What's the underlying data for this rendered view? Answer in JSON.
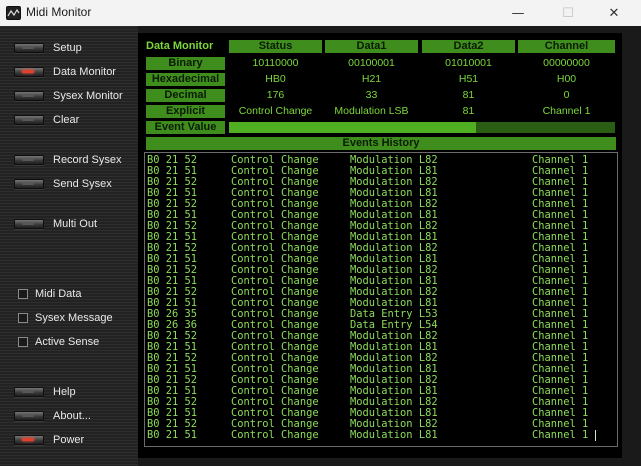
{
  "window": {
    "title": "Midi Monitor",
    "minimize_glyph": "—",
    "maximize_glyph": "☐",
    "close_glyph": "✕"
  },
  "sidebar": {
    "buttons": [
      {
        "label": "Setup",
        "led_on": false
      },
      {
        "label": "Data Monitor",
        "led_on": true
      },
      {
        "label": "Sysex Monitor",
        "led_on": false
      },
      {
        "label": "Clear",
        "led_on": false
      },
      {
        "label": "Record Sysex",
        "led_on": false
      },
      {
        "label": "Send Sysex",
        "led_on": false
      },
      {
        "label": "Multi Out",
        "led_on": false
      }
    ],
    "checkboxes": [
      {
        "label": "Midi Data",
        "checked": false
      },
      {
        "label": "Sysex Message",
        "checked": false
      },
      {
        "label": "Active Sense",
        "checked": false
      }
    ],
    "bottom_buttons": [
      {
        "label": "Help",
        "led_on": false
      },
      {
        "label": "About...",
        "led_on": false
      },
      {
        "label": "Power",
        "led_on": true
      }
    ]
  },
  "monitor": {
    "title": "Data Monitor",
    "columns": [
      "Status",
      "Data1",
      "Data2",
      "Channel"
    ],
    "rows": [
      {
        "label": "Binary",
        "values": [
          "10110000",
          "00100001",
          "01010001",
          "00000000"
        ]
      },
      {
        "label": "Hexadecimal",
        "values": [
          "HB0",
          "H21",
          "H51",
          "H00"
        ]
      },
      {
        "label": "Decimal",
        "values": [
          "176",
          "33",
          "81",
          "0"
        ]
      },
      {
        "label": "Explicit",
        "values": [
          "Control Change",
          "Modulation LSB",
          "81",
          "Channel 1"
        ]
      }
    ],
    "event_value_label": "Event Value",
    "event_value_fraction": 0.64
  },
  "history": {
    "title": "Events History",
    "rows": [
      [
        "B0 21 52",
        "Control Change",
        "Modulation L82",
        "Channel 1"
      ],
      [
        "B0 21 51",
        "Control Change",
        "Modulation L81",
        "Channel 1"
      ],
      [
        "B0 21 52",
        "Control Change",
        "Modulation L82",
        "Channel 1"
      ],
      [
        "B0 21 51",
        "Control Change",
        "Modulation L81",
        "Channel 1"
      ],
      [
        "B0 21 52",
        "Control Change",
        "Modulation L82",
        "Channel 1"
      ],
      [
        "B0 21 51",
        "Control Change",
        "Modulation L81",
        "Channel 1"
      ],
      [
        "B0 21 52",
        "Control Change",
        "Modulation L82",
        "Channel 1"
      ],
      [
        "B0 21 51",
        "Control Change",
        "Modulation L81",
        "Channel 1"
      ],
      [
        "B0 21 52",
        "Control Change",
        "Modulation L82",
        "Channel 1"
      ],
      [
        "B0 21 51",
        "Control Change",
        "Modulation L81",
        "Channel 1"
      ],
      [
        "B0 21 52",
        "Control Change",
        "Modulation L82",
        "Channel 1"
      ],
      [
        "B0 21 51",
        "Control Change",
        "Modulation L81",
        "Channel 1"
      ],
      [
        "B0 21 52",
        "Control Change",
        "Modulation L82",
        "Channel 1"
      ],
      [
        "B0 21 51",
        "Control Change",
        "Modulation L81",
        "Channel 1"
      ],
      [
        "B0 26 35",
        "Control Change",
        "Data Entry L53",
        "Channel 1"
      ],
      [
        "B0 26 36",
        "Control Change",
        "Data Entry L54",
        "Channel 1"
      ],
      [
        "B0 21 52",
        "Control Change",
        "Modulation L82",
        "Channel 1"
      ],
      [
        "B0 21 51",
        "Control Change",
        "Modulation L81",
        "Channel 1"
      ],
      [
        "B0 21 52",
        "Control Change",
        "Modulation L82",
        "Channel 1"
      ],
      [
        "B0 21 51",
        "Control Change",
        "Modulation L81",
        "Channel 1"
      ],
      [
        "B0 21 52",
        "Control Change",
        "Modulation L82",
        "Channel 1"
      ],
      [
        "B0 21 51",
        "Control Change",
        "Modulation L81",
        "Channel 1"
      ],
      [
        "B0 21 52",
        "Control Change",
        "Modulation L82",
        "Channel 1"
      ],
      [
        "B0 21 51",
        "Control Change",
        "Modulation L81",
        "Channel 1"
      ],
      [
        "B0 21 52",
        "Control Change",
        "Modulation L82",
        "Channel 1"
      ],
      [
        "B0 21 51",
        "Control Change",
        "Modulation L81",
        "Channel 1"
      ]
    ]
  },
  "colors": {
    "header_green": "#3f8e1d",
    "text_green": "#7cd83a",
    "bar_fill": "#4fae22",
    "led_red": "#e0402c"
  }
}
